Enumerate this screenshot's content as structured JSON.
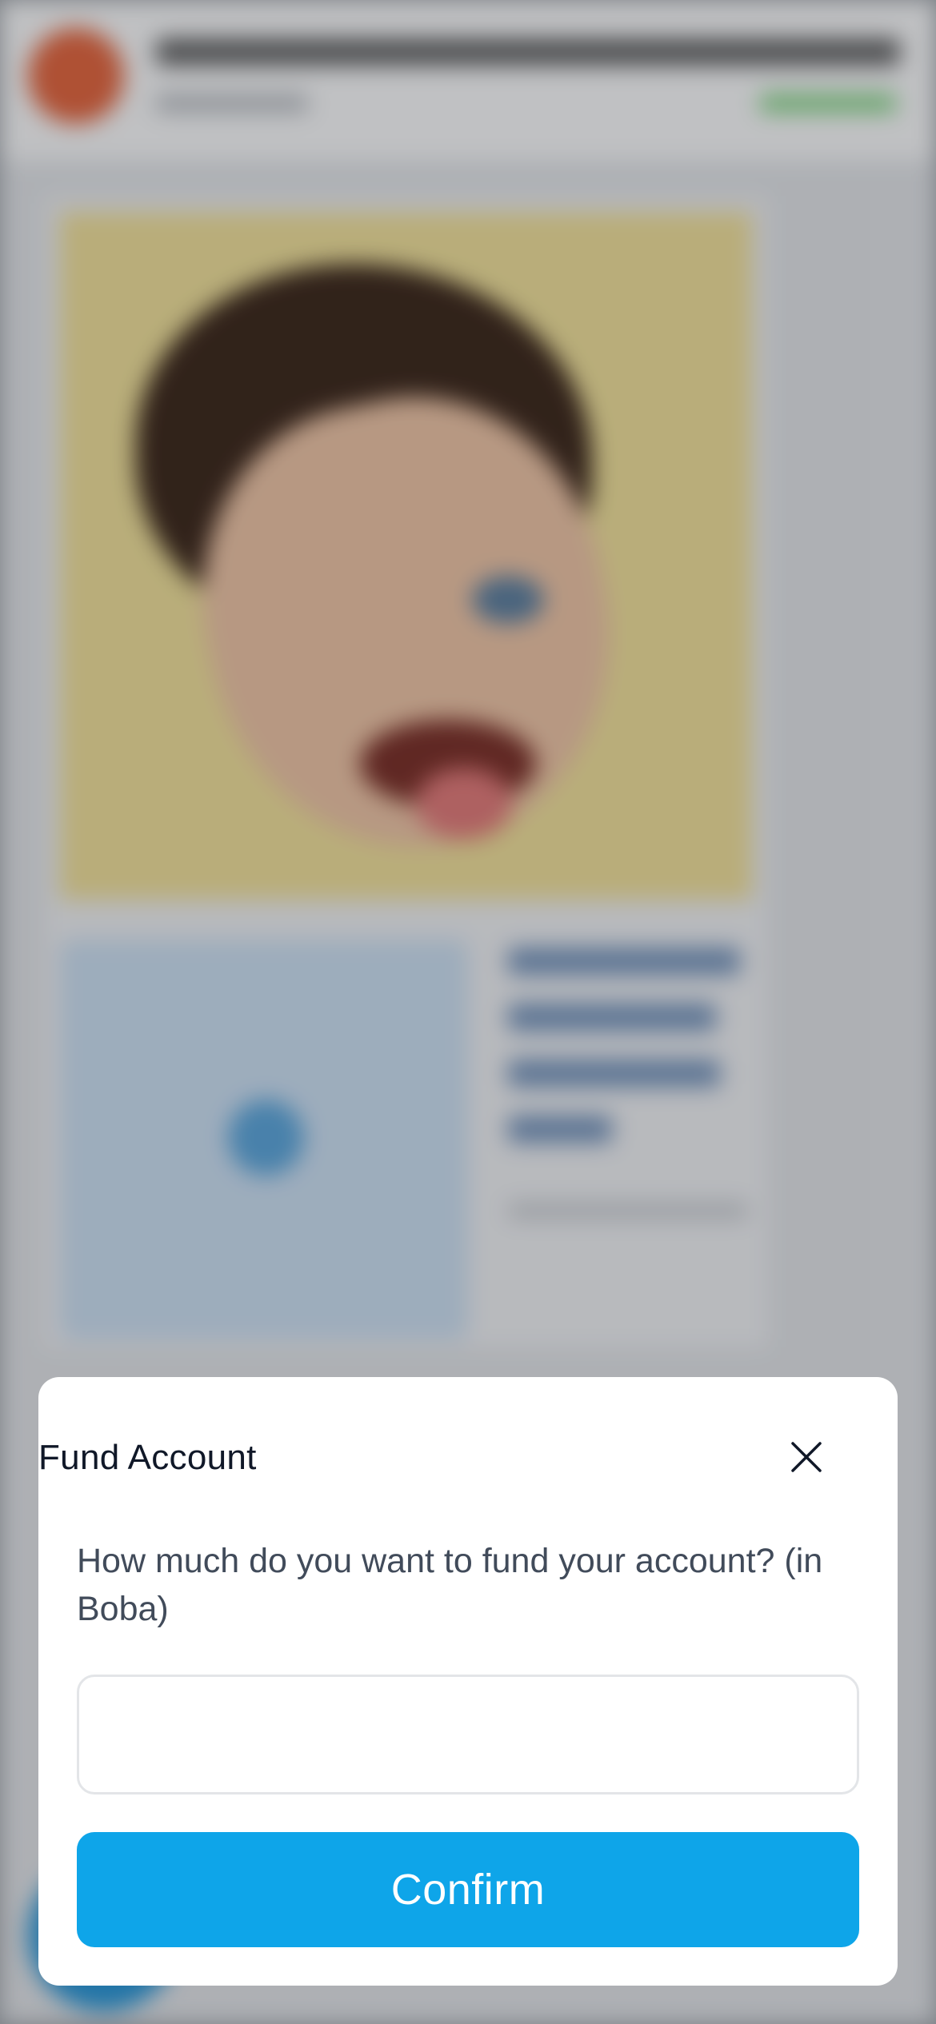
{
  "modal": {
    "title": "Fund Account",
    "question": "How much do you want to fund your account? (in Boba)",
    "amount_input": {
      "value": "",
      "placeholder": ""
    },
    "confirm_label": "Confirm",
    "close_icon": "close-icon"
  },
  "colors": {
    "accent": "#0ea5e9",
    "title_text": "#101828",
    "body_text": "#414b5a",
    "input_border": "#e3e5e8",
    "modal_bg": "#ffffff"
  }
}
